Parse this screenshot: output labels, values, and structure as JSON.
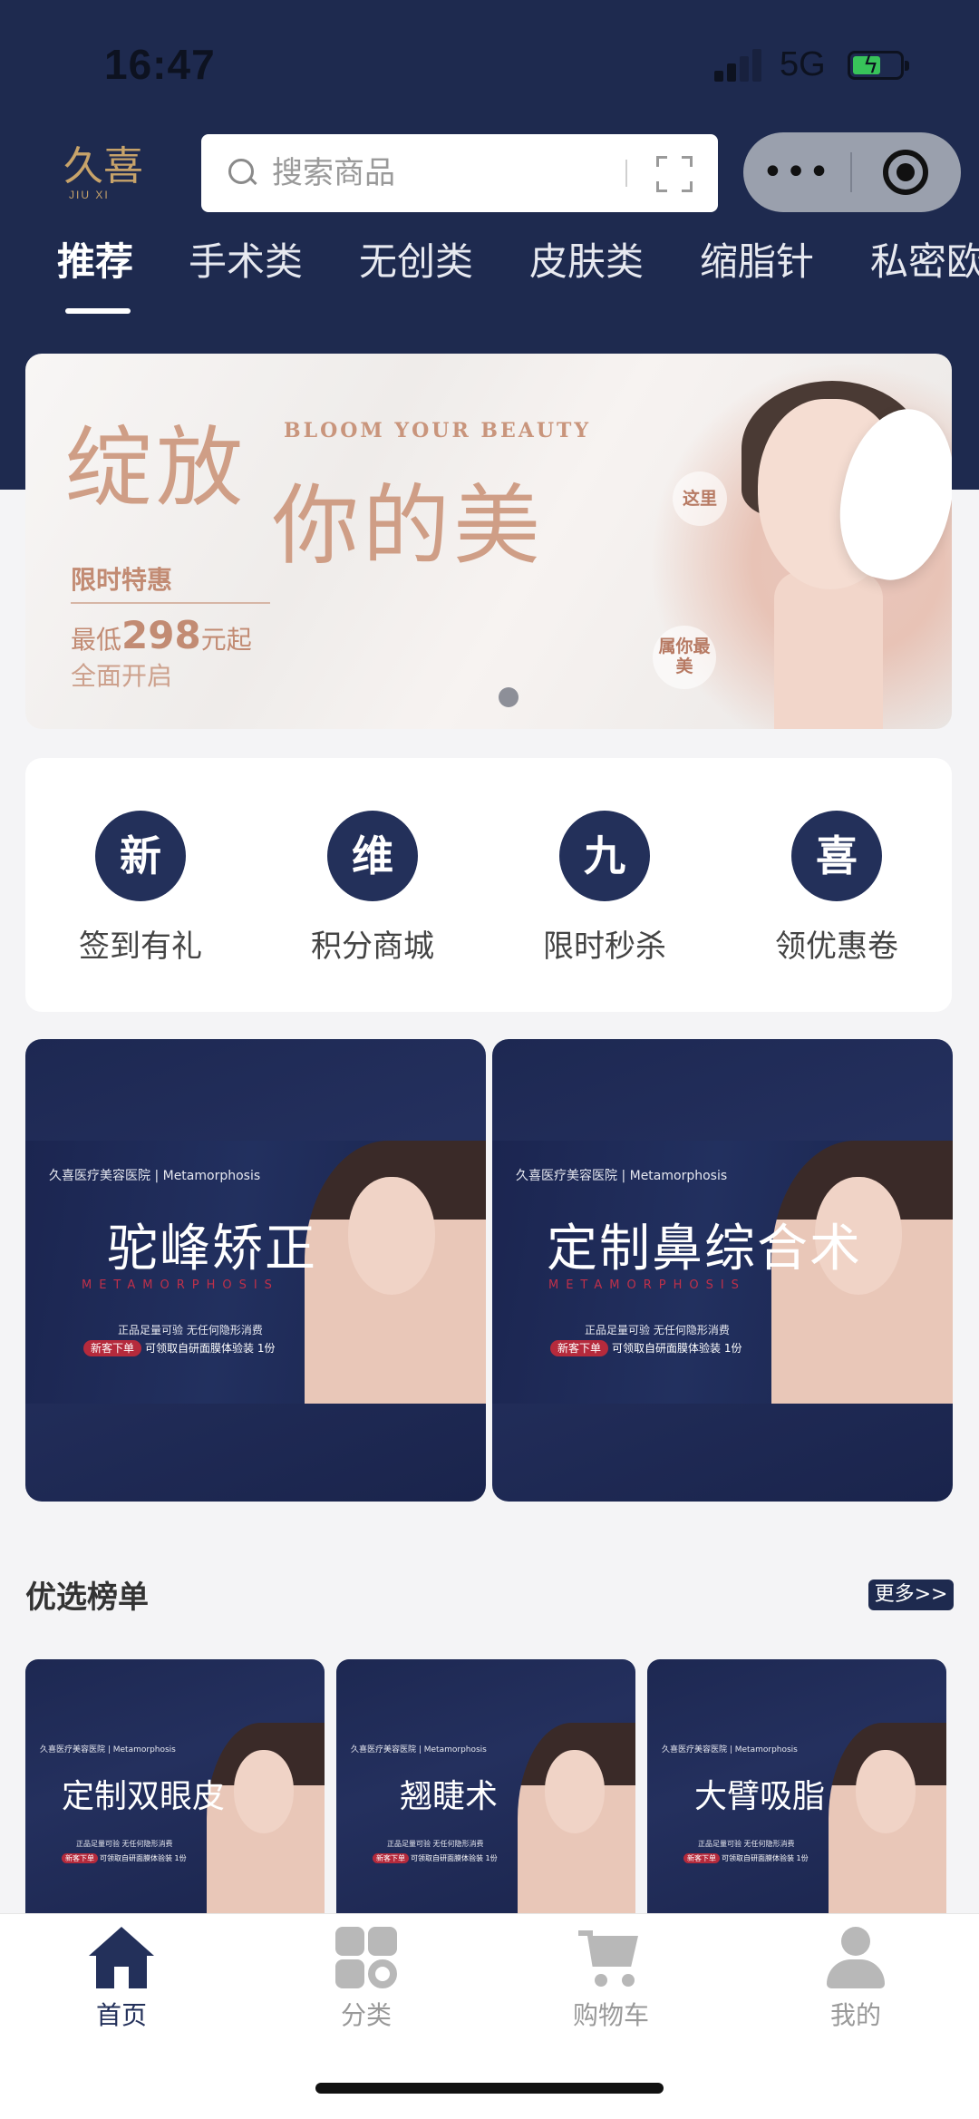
{
  "status_bar": {
    "time": "16:47",
    "network": "5G",
    "battery_level": 0.45
  },
  "header": {
    "logo_text": "久喜",
    "logo_sub": "JIU XI",
    "search_placeholder": "搜索商品",
    "capsule_more": "•••"
  },
  "tabs": [
    {
      "label": "推荐",
      "active": true
    },
    {
      "label": "手术类"
    },
    {
      "label": "无创类"
    },
    {
      "label": "皮肤类"
    },
    {
      "label": "缩脂针"
    },
    {
      "label": "私密欧"
    }
  ],
  "banner": {
    "title_line1": "绽放",
    "title_line2": "你的美",
    "title_en": "BLOOM YOUR BEAUTY",
    "promo_label": "限时特惠",
    "price_prefix": "最低",
    "price_value": "298",
    "price_suffix": "元起",
    "subline": "全面开启",
    "bubble_1": "这里",
    "bubble_2": "属你最美",
    "slides": 1,
    "current_slide": 1
  },
  "quick_nav": [
    {
      "icon_char": "新",
      "label": "签到有礼"
    },
    {
      "icon_char": "维",
      "label": "积分商城"
    },
    {
      "icon_char": "九",
      "label": "限时秒杀"
    },
    {
      "icon_char": "喜",
      "label": "领优惠卷"
    }
  ],
  "promo_cards": [
    {
      "hospital": "久喜医疗美容医院 | Metamorphosis",
      "title": "驼峰矫正",
      "meta": "METAMORPHOSIS",
      "desc": "正品足量可验 无任何隐形消费",
      "tag": "新客下单",
      "tag_text": "可领取自研面膜体验装",
      "tag_suffix": "1份"
    },
    {
      "hospital": "久喜医疗美容医院 | Metamorphosis",
      "title": "定制鼻综合术",
      "meta": "METAMORPHOSIS",
      "desc": "正品足量可验 无任何隐形消费",
      "tag": "新客下单",
      "tag_text": "可领取自研面膜体验装",
      "tag_suffix": "1份"
    }
  ],
  "ranking": {
    "title": "优选榜单",
    "more_label": "更多>>",
    "items": [
      {
        "hospital": "久喜医疗美容医院 | Metamorphosis",
        "title": "定制双眼皮",
        "desc": "正品足量可验 无任何隐形消费",
        "tag": "新客下单",
        "tag_text": "可领取自研面膜体验装 1份"
      },
      {
        "hospital": "久喜医疗美容医院 | Metamorphosis",
        "title": "翘睫术",
        "desc": "正品足量可验 无任何隐形消费",
        "tag": "新客下单",
        "tag_text": "可领取自研面膜体验装 1份"
      },
      {
        "hospital": "久喜医疗美容医院 | Metamorphosis",
        "title": "大臂吸脂",
        "desc": "正品足量可验 无任何隐形消费",
        "tag": "新客下单",
        "tag_text": "可领取自研面膜体验装 1份"
      }
    ]
  },
  "tabbar": [
    {
      "label": "首页",
      "icon": "home-icon",
      "active": true
    },
    {
      "label": "分类",
      "icon": "category-icon"
    },
    {
      "label": "购物车",
      "icon": "cart-icon"
    },
    {
      "label": "我的",
      "icon": "user-icon"
    }
  ],
  "colors": {
    "navy": "#1e2a4f",
    "accent_gold": "#c7a36a",
    "banner_rose": "#cf9e86",
    "tag_red": "#b52a3c"
  }
}
